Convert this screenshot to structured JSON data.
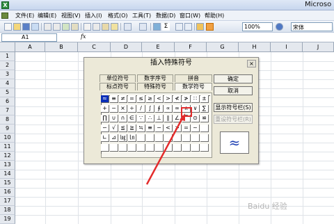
{
  "window": {
    "title": "Microso",
    "app_icon": "X"
  },
  "menu": [
    "文件(E)",
    "编辑(E)",
    "视图(V)",
    "插入(I)",
    "格式(O)",
    "工具(T)",
    "数据(D)",
    "窗口(W)",
    "帮助(H)"
  ],
  "toolbar": {
    "zoom": "100%",
    "font": "宋体",
    "sum": "Σ"
  },
  "formula_bar": {
    "cell_ref": "A1",
    "fx": "fx"
  },
  "columns": [
    "A",
    "B",
    "C",
    "D",
    "E",
    "F",
    "G",
    "H",
    "I",
    "J"
  ],
  "rows": [
    "1",
    "2",
    "3",
    "4",
    "5",
    "6",
    "7",
    "8",
    "9",
    "10",
    "11",
    "12",
    "13",
    "14",
    "15",
    "16",
    "17",
    "18",
    "19"
  ],
  "dialog": {
    "title": "插入特殊符号",
    "close": "×",
    "tabs_top": [
      "单位符号",
      "数字序号",
      "拼音"
    ],
    "tabs_bottom": [
      "标点符号",
      "特殊符号",
      "数学符号"
    ],
    "symbols": [
      [
        "≈",
        "≡",
        "≠",
        "=",
        "≤",
        "≥",
        "<",
        ">",
        "≮",
        "≯",
        "∷",
        "±"
      ],
      [
        "+",
        "−",
        "×",
        "÷",
        "/",
        "∫",
        "∮",
        "∝",
        "∞",
        "∧",
        "∨",
        "∑"
      ],
      [
        "∏",
        "∪",
        "∩",
        "∈",
        "∵",
        "∴",
        "⊥",
        "∥",
        "∠",
        "⌒",
        "⊙",
        "≌"
      ],
      [
        "∽",
        "√",
        "≦",
        "≧",
        "≒",
        "≡",
        "−",
        "<",
        ">",
        "=",
        "~",
        ""
      ],
      [
        "∟",
        "⊿",
        "㏒",
        "㏑",
        "",
        "",
        "",
        "",
        "",
        "",
        "",
        ""
      ],
      [
        "",
        "",
        "",
        "",
        "",
        "",
        "",
        "",
        "",
        "",
        "",
        ""
      ]
    ],
    "buttons": {
      "ok": "确定",
      "cancel": "取消",
      "show_bar": "显示符号栏(S)",
      "reset_bar": "重设符号栏(R)"
    },
    "preview": "≈"
  },
  "watermark": "Baidu 经验",
  "colors": {
    "accent": "#0a2fb8",
    "highlight": "#e32b2b"
  }
}
